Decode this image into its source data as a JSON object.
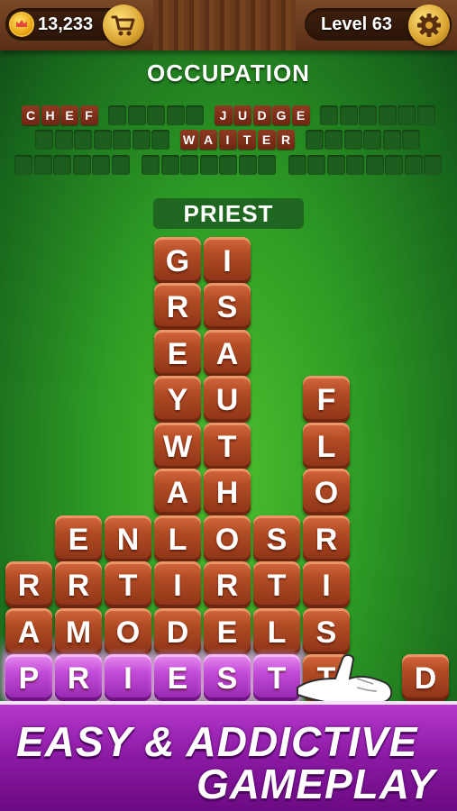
{
  "header": {
    "coins": "13,233",
    "level": "Level 63",
    "coin_icon": "crown-coin-icon",
    "shop_icon": "cart-icon",
    "settings_icon": "gear-icon"
  },
  "category": "OCCUPATION",
  "answers": {
    "row1": [
      {
        "word": "CHEF",
        "letters": [
          "C",
          "H",
          "E",
          "F"
        ],
        "found": true
      },
      {
        "word": "",
        "letters": [
          "",
          "",
          "",
          "",
          ""
        ],
        "found": false
      },
      {
        "word": "JUDGE",
        "letters": [
          "J",
          "U",
          "D",
          "G",
          "E"
        ],
        "found": true
      },
      {
        "word": "",
        "letters": [
          "",
          "",
          "",
          "",
          "",
          ""
        ],
        "found": false
      }
    ],
    "row2": [
      {
        "word": "",
        "letters": [
          "",
          "",
          "",
          "",
          "",
          "",
          ""
        ],
        "found": false
      },
      {
        "word": "WAITER",
        "letters": [
          "W",
          "A",
          "I",
          "T",
          "E",
          "R"
        ],
        "found": true
      },
      {
        "word": "",
        "letters": [
          "",
          "",
          "",
          "",
          "",
          ""
        ],
        "found": false
      }
    ],
    "row3": [
      {
        "word": "",
        "letters": [
          "",
          "",
          "",
          "",
          "",
          ""
        ],
        "found": false
      },
      {
        "word": "",
        "letters": [
          "",
          "",
          "",
          "",
          "",
          "",
          ""
        ],
        "found": false
      },
      {
        "word": "",
        "letters": [
          "",
          "",
          "",
          "",
          "",
          "",
          "",
          ""
        ],
        "found": false
      }
    ]
  },
  "current_word": "PRIEST",
  "grid": {
    "columns": [
      [
        "",
        "",
        "",
        "",
        "",
        "R",
        "A",
        "P"
      ],
      [
        "",
        "",
        "",
        "",
        "E",
        "R",
        "M",
        "R"
      ],
      [
        "",
        "",
        "",
        "",
        "N",
        "T",
        "O",
        "I"
      ],
      [
        "G",
        "R",
        "E",
        "Y",
        "W",
        "A",
        "L",
        "I",
        "D",
        "E"
      ],
      [
        "I",
        "S",
        "A",
        "U",
        "T",
        "H",
        "O",
        "R",
        "E",
        "S"
      ],
      [
        "",
        "",
        "",
        "",
        "S",
        "T",
        "L",
        "T"
      ],
      [
        "F",
        "L",
        "O",
        "R",
        "I",
        "S",
        "T"
      ],
      [
        "",
        "",
        "",
        "",
        "",
        "",
        "",
        "D"
      ]
    ],
    "selected": [
      "P",
      "R",
      "I",
      "E",
      "S",
      "T"
    ]
  },
  "tagline": {
    "line1": "EASY & ADDICTIVE",
    "line2": "GAMEPLAY"
  },
  "colors": {
    "background": "#2e9d25",
    "tile": "#b24c25",
    "selected_tile": "#c24ad8",
    "banner": "#8c1aa4"
  }
}
